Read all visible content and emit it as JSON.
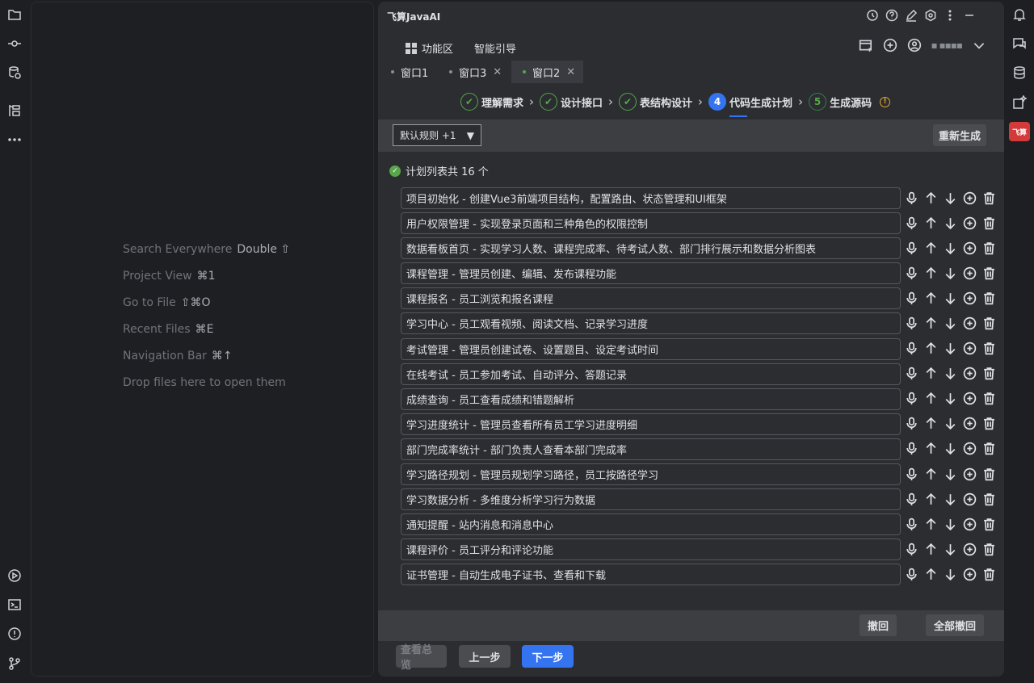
{
  "editor_hints": [
    {
      "label": "Search Everywhere",
      "key": "Double ⇧"
    },
    {
      "label": "Project View",
      "key": "⌘1"
    },
    {
      "label": "Go to File",
      "key": "⇧⌘O"
    },
    {
      "label": "Recent Files",
      "key": "⌘E"
    },
    {
      "label": "Navigation Bar",
      "key": "⌘↑"
    },
    {
      "label": "Drop files here to open them",
      "key": ""
    }
  ],
  "plugin": {
    "title": "飞算JavaAI",
    "rail_label": "飞算",
    "topbar": {
      "feature_area": "功能区",
      "smart_guide": "智能引导",
      "user_name": "▪ ▪▪▪▪"
    },
    "tabs": [
      {
        "label": "窗口1",
        "closable": false,
        "active": false
      },
      {
        "label": "窗口3",
        "closable": true,
        "active": false
      },
      {
        "label": "窗口2",
        "closable": true,
        "active": true
      }
    ],
    "steps": [
      {
        "label": "理解需求",
        "status": "done"
      },
      {
        "label": "设计接口",
        "status": "done"
      },
      {
        "label": "表结构设计",
        "status": "done"
      },
      {
        "label": "代码生成计划",
        "number": "4",
        "status": "current"
      },
      {
        "label": "生成源码",
        "number": "5",
        "status": "todo"
      }
    ],
    "rule_select": "默认规则 +1",
    "regenerate": "重新生成",
    "plan_count": "计划列表共 16 个",
    "plans": [
      "项目初始化 - 创建Vue3前端项目结构，配置路由、状态管理和UI框架",
      "用户权限管理 - 实现登录页面和三种角色的权限控制",
      "数据看板首页 - 实现学习人数、课程完成率、待考试人数、部门排行展示和数据分析图表",
      "课程管理 - 管理员创建、编辑、发布课程功能",
      "课程报名 - 员工浏览和报名课程",
      "学习中心 - 员工观看视频、阅读文档、记录学习进度",
      "考试管理 - 管理员创建试卷、设置题目、设定考试时间",
      "在线考试 - 员工参加考试、自动评分、答题记录",
      "成绩查询 - 员工查看成绩和错题解析",
      "学习进度统计 - 管理员查看所有员工学习进度明细",
      "部门完成率统计 - 部门负责人查看本部门完成率",
      "学习路径规划 - 管理员规划学习路径，员工按路径学习",
      "学习数据分析 - 多维度分析学习行为数据",
      "通知提醒 - 站内消息和消息中心",
      "课程评价 - 员工评分和评论功能",
      "证书管理 - 自动生成电子证书、查看和下载"
    ],
    "undo": "撤回",
    "undo_all": "全部撤回",
    "view_overview": "查看总览",
    "prev_step": "上一步",
    "next_step": "下一步"
  },
  "colors": {
    "accent": "#3574f0",
    "success": "#57a64a",
    "warning": "#e5a82e",
    "brand": "#d33a3a"
  }
}
